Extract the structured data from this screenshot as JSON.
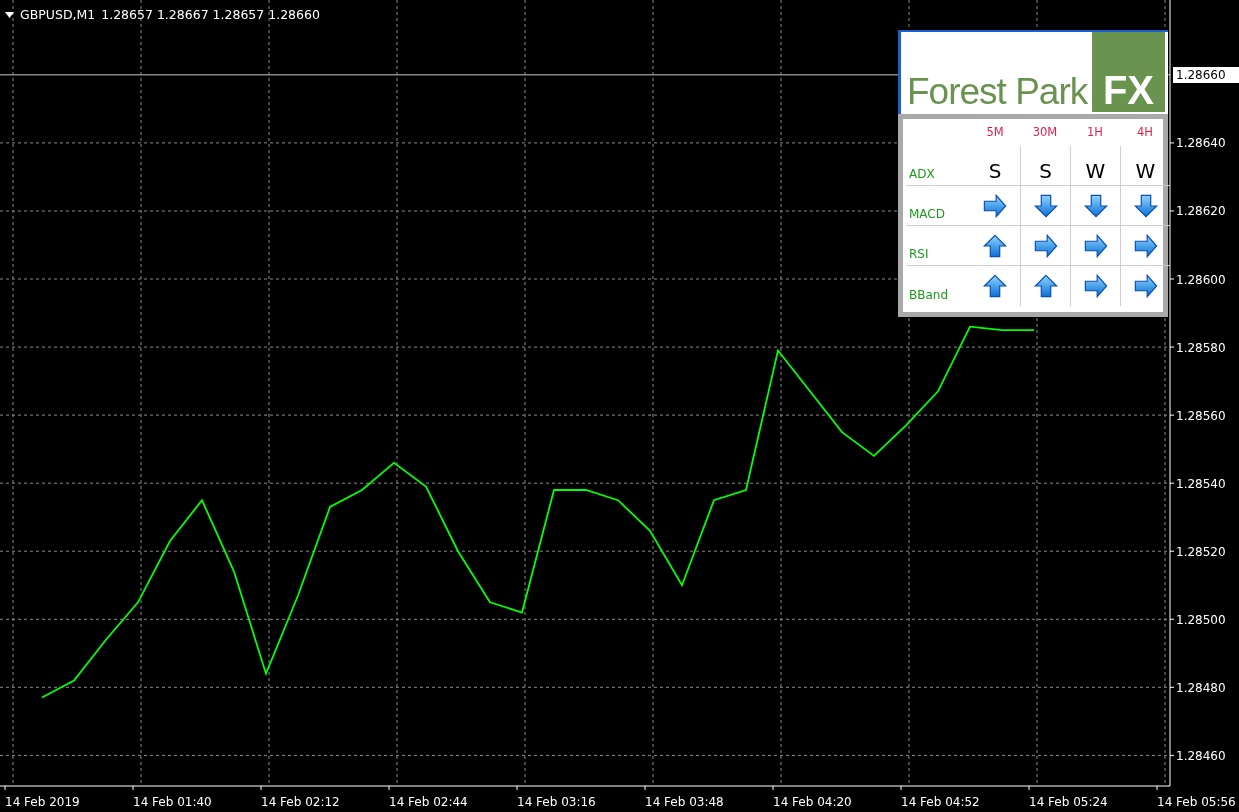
{
  "header": {
    "symbol": "GBPUSD,M1",
    "quote": "1.28657 1.28667 1.28657 1.28660"
  },
  "chart_data": {
    "type": "line",
    "grid": true,
    "categories": [
      "14 Feb 2019",
      null,
      null,
      null,
      "14 Feb 01:40",
      null,
      null,
      null,
      "14 Feb 02:12",
      null,
      null,
      null,
      "14 Feb 02:44",
      null,
      null,
      null,
      "14 Feb 03:16",
      null,
      null,
      null,
      "14 Feb 03:48",
      null,
      null,
      null,
      "14 Feb 04:20",
      null,
      null,
      null,
      "14 Feb 04:52",
      null,
      null,
      null,
      "14 Feb 05:24",
      null,
      null,
      null,
      "14 Feb 05:56"
    ],
    "series": [
      {
        "color": "#00ff00",
        "values": [
          1.28477,
          1.28482,
          1.28494,
          1.28505,
          1.28523,
          1.28535,
          1.28514,
          1.28484,
          1.28507,
          1.28533,
          1.28538,
          1.28546,
          1.28539,
          1.2852,
          1.28505,
          1.28502,
          1.28538,
          1.28538,
          1.28535,
          1.28526,
          1.2851,
          1.28535,
          1.28538,
          1.28579,
          1.28567,
          1.28555,
          1.28548,
          1.28557,
          1.28567,
          1.28586,
          1.28585,
          1.28585,
          null,
          null,
          null,
          null,
          null
        ]
      }
    ],
    "ref_lines": [
      {
        "axis": "y",
        "value": 1.2866,
        "label": "1.28660"
      }
    ],
    "ylim": [
      1.28451,
      1.28682
    ],
    "yticks": [
      {
        "value": 1.2846,
        "label": "1.28460"
      },
      {
        "value": 1.2848,
        "label": "1.28480"
      },
      {
        "value": 1.285,
        "label": "1.28500"
      },
      {
        "value": 1.2852,
        "label": "1.28520"
      },
      {
        "value": 1.2854,
        "label": "1.28540"
      },
      {
        "value": 1.2856,
        "label": "1.28560"
      },
      {
        "value": 1.2858,
        "label": "1.28580"
      },
      {
        "value": 1.286,
        "label": "1.28600"
      },
      {
        "value": 1.2862,
        "label": "1.28620"
      },
      {
        "value": 1.2864,
        "label": "1.28640"
      }
    ]
  },
  "panel": {
    "logo": {
      "text": "Forest Park",
      "mark": "FX"
    },
    "timeframes": [
      "5M",
      "30M",
      "1H",
      "4H"
    ],
    "rows": [
      {
        "indicator": "ADX",
        "cells": [
          {
            "kind": "text",
            "text": "S"
          },
          {
            "kind": "text",
            "text": "S"
          },
          {
            "kind": "text",
            "text": "W"
          },
          {
            "kind": "text",
            "text": "W"
          }
        ]
      },
      {
        "indicator": "MACD",
        "cells": [
          {
            "kind": "right"
          },
          {
            "kind": "down"
          },
          {
            "kind": "down"
          },
          {
            "kind": "down"
          }
        ]
      },
      {
        "indicator": "RSI",
        "cells": [
          {
            "kind": "up"
          },
          {
            "kind": "right"
          },
          {
            "kind": "right"
          },
          {
            "kind": "right"
          }
        ]
      },
      {
        "indicator": "BBand",
        "cells": [
          {
            "kind": "up"
          },
          {
            "kind": "up"
          },
          {
            "kind": "right"
          },
          {
            "kind": "right"
          }
        ]
      }
    ]
  }
}
